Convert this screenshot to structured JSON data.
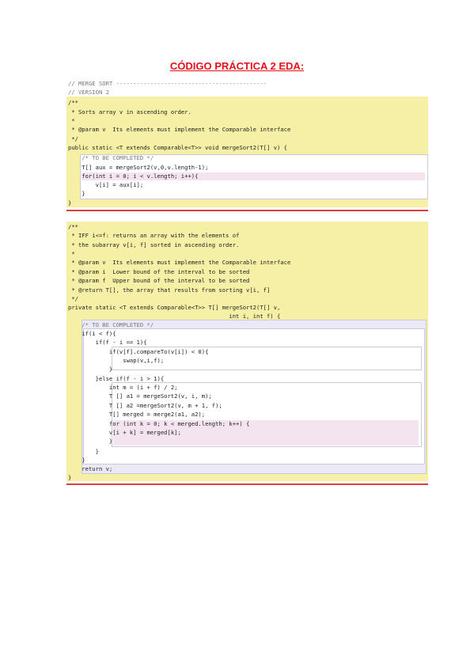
{
  "title": "CÓDIGO PRÁCTICA 2 EDA:",
  "snippet1": {
    "lines": [
      "// MERGE SORT --------------------------------------------",
      "// VERSION 2",
      "/**",
      " * Sorts array v in ascending order.",
      " *",
      " * @param v  Its elements must implement the Comparable interface",
      " */",
      "public static <T extends Comparable<T>> void mergeSort2(T[] v) {",
      "    /* TO BE COMPLETED */",
      "    T[] aux = mergeSort2(v,0,v.length-1);",
      "    for(int i = 0; i < v.length; i++){",
      "        v[i] = aux[i];",
      "    }",
      "}"
    ]
  },
  "snippet2": {
    "lines": [
      "/**",
      " * IFF i<=f: returns an array with the elements of",
      " * the subarray v[i, f] sorted in ascending order.",
      " *",
      " * @param v  Its elements must implement the Comparable interface",
      " * @param i  Lower bound of the interval to be sorted",
      " * @param f  Upper bound of the interval to be sorted",
      " * @return T[], the array that results from sorting v[i, f]",
      " */",
      "private static <T extends Comparable<T>> T[] mergeSort2(T[] v,",
      "                                               int i, int f) {",
      "    /* TO BE COMPLETED */",
      "    if(i < f){",
      "        if(f - i == 1){",
      "            if(v[f].compareTo(v[i]) < 0){",
      "                swap(v,i,f);",
      "            }",
      "        }else if(f - i > 1){",
      "            int m = (i + f) / 2;",
      "            T [] a1 = mergeSort2(v, i, m);",
      "            T [] a2 =mergeSort2(v, m + 1, f);",
      "            T[] merged = merge2(a1, a2);",
      "            for (int k = 0; k < merged.length; k++) {",
      "            v[i + k] = merged[k];",
      "            }",
      "        }",
      "    }",
      "    return v;",
      "}"
    ]
  }
}
